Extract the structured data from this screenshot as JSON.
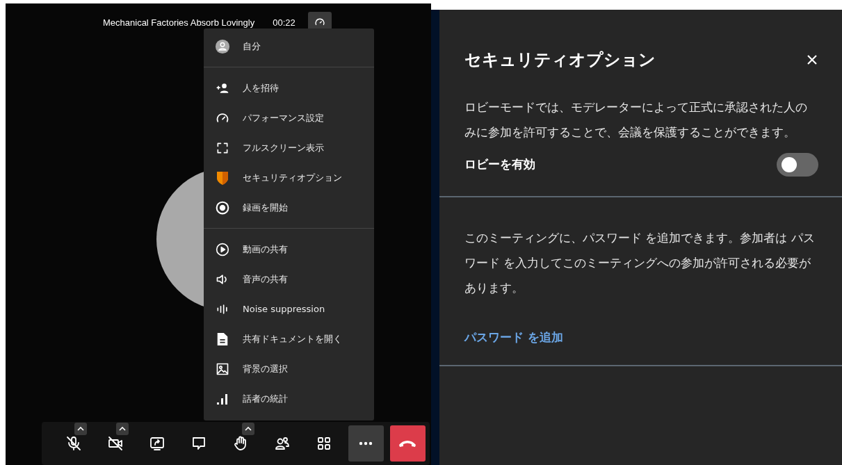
{
  "header": {
    "title": "Mechanical Factories Absorb Lovingly",
    "timer": "00:22"
  },
  "menu": {
    "sections": [
      [
        {
          "label": "自分"
        }
      ],
      [
        {
          "label": "人を招待"
        },
        {
          "label": "パフォーマンス設定"
        },
        {
          "label": "フルスクリーン表示"
        },
        {
          "label": "セキュリティオプション"
        },
        {
          "label": "録画を開始"
        }
      ],
      [
        {
          "label": "動画の共有"
        },
        {
          "label": "音声の共有"
        },
        {
          "label": "Noise suppression"
        },
        {
          "label": "共有ドキュメントを開く"
        },
        {
          "label": "背景の選択"
        },
        {
          "label": "話者の統計"
        }
      ]
    ]
  },
  "toolbar": [
    {
      "caret": true,
      "selected": false
    },
    {
      "caret": true,
      "selected": false
    },
    {
      "caret": false,
      "selected": false
    },
    {
      "caret": false,
      "selected": false
    },
    {
      "caret": true,
      "selected": false
    },
    {
      "caret": false,
      "selected": false
    },
    {
      "caret": false,
      "selected": false
    },
    {
      "caret": false,
      "selected": true
    },
    {
      "caret": false,
      "selected": false
    }
  ],
  "panel": {
    "title": "セキュリティオプション",
    "lobby_description": "ロビーモードでは、モデレーターによって正式に承認された人のみに参加を許可することで、会議を保護することができます。",
    "lobby_label": "ロビーを有効",
    "lobby_on": false,
    "password_description": "このミーティングに、パスワード を追加できます。参加者は パスワード を入力してこのミーティングへの参加が許可される必要があります。",
    "add_password": "パスワード を追加"
  }
}
